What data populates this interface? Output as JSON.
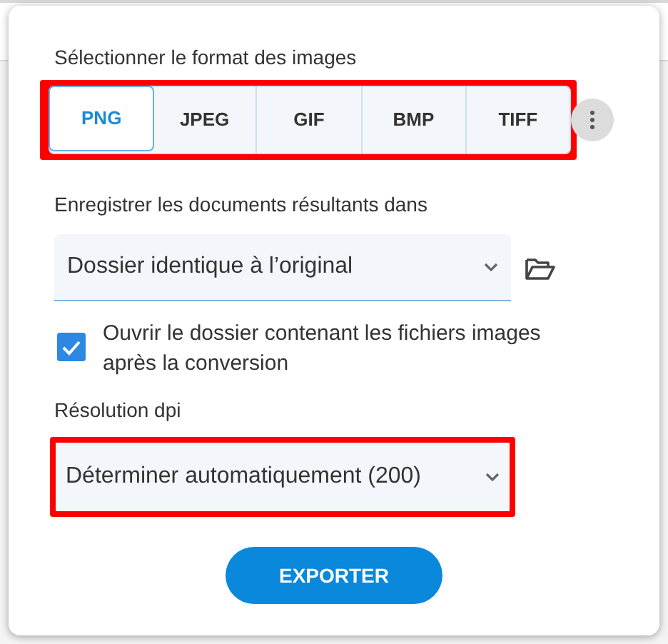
{
  "format_section": {
    "label": "Sélectionner le format des images",
    "highlighted": true,
    "formats": [
      {
        "label": "PNG",
        "selected": true
      },
      {
        "label": "JPEG",
        "selected": false
      },
      {
        "label": "GIF",
        "selected": false
      },
      {
        "label": "BMP",
        "selected": false
      },
      {
        "label": "TIFF",
        "selected": false
      }
    ]
  },
  "output_section": {
    "label": "Enregistrer les documents résultants dans",
    "folder_select": "Dossier identique à l’original"
  },
  "open_folder_checkbox": {
    "label": "Ouvrir le dossier contenant les fichiers images après la conversion",
    "checked": true
  },
  "dpi_section": {
    "label": "Résolution dpi",
    "value": "Déterminer automatiquement (200)",
    "highlighted": true
  },
  "export_button": "EXPORTER"
}
